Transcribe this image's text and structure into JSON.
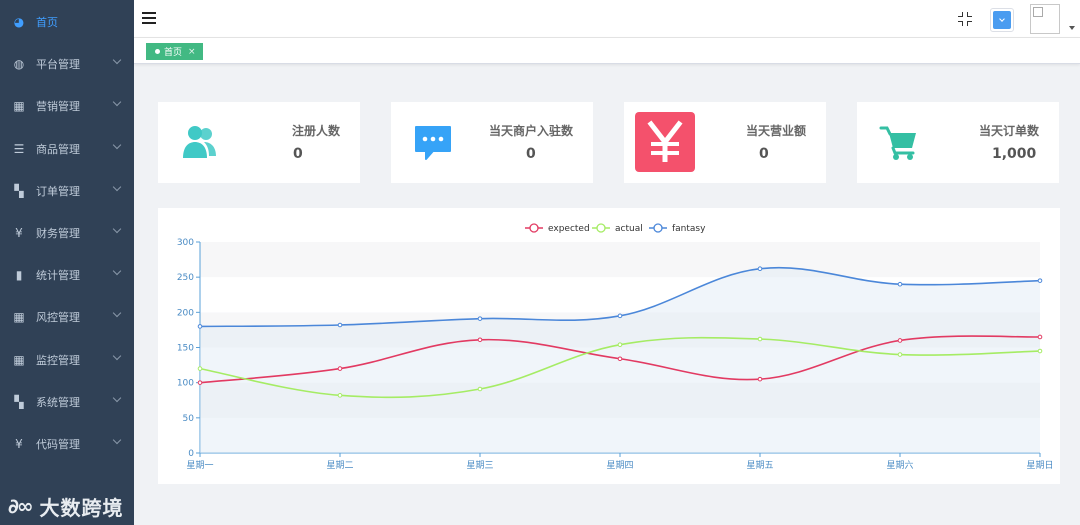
{
  "sidebar": {
    "items": [
      {
        "label": "首页",
        "icon": "dashboard-icon",
        "glyph": "◕",
        "active": true,
        "has_children": false
      },
      {
        "label": "平台管理",
        "icon": "globe-icon",
        "glyph": "◍",
        "active": false,
        "has_children": true
      },
      {
        "label": "营销管理",
        "icon": "table-icon",
        "glyph": "▦",
        "active": false,
        "has_children": true
      },
      {
        "label": "商品管理",
        "icon": "list-icon",
        "glyph": "☰",
        "active": false,
        "has_children": true
      },
      {
        "label": "订单管理",
        "icon": "grid-icon",
        "glyph": "▚",
        "active": false,
        "has_children": true
      },
      {
        "label": "财务管理",
        "icon": "yen-icon",
        "glyph": "¥",
        "active": false,
        "has_children": true
      },
      {
        "label": "统计管理",
        "icon": "bar-chart-icon",
        "glyph": "▮",
        "active": false,
        "has_children": true
      },
      {
        "label": "风控管理",
        "icon": "table-icon",
        "glyph": "▦",
        "active": false,
        "has_children": true
      },
      {
        "label": "监控管理",
        "icon": "table-icon",
        "glyph": "▦",
        "active": false,
        "has_children": true
      },
      {
        "label": "系统管理",
        "icon": "grid-icon",
        "glyph": "▚",
        "active": false,
        "has_children": true
      },
      {
        "label": "代码管理",
        "icon": "yen-icon",
        "glyph": "¥",
        "active": false,
        "has_children": true
      }
    ]
  },
  "watermark": {
    "logo": "∂∞",
    "text": "大数跨境"
  },
  "tags": [
    {
      "label": "首页",
      "close": "×"
    }
  ],
  "cards": [
    {
      "title": "注册人数",
      "value": "0",
      "icon": "peoples-icon",
      "color": "#40c9c6"
    },
    {
      "title": "当天商户入驻数",
      "value": "0",
      "icon": "message-icon",
      "color": "#36a3f7"
    },
    {
      "title": "当天营业额",
      "value": "0",
      "icon": "yen-icon",
      "color": "#f4516c"
    },
    {
      "title": "当天订单数",
      "value": "1,000",
      "icon": "shopping-cart-icon",
      "color": "#34bfa3"
    }
  ],
  "chart_data": {
    "type": "line",
    "categories": [
      "星期一",
      "星期二",
      "星期三",
      "星期四",
      "星期五",
      "星期六",
      "星期日"
    ],
    "series": [
      {
        "name": "expected",
        "color": "#e23a62",
        "values": [
          100,
          120,
          161,
          134,
          105,
          160,
          165
        ]
      },
      {
        "name": "actual",
        "color": "#a5ec64",
        "values": [
          120,
          82,
          91,
          154,
          162,
          140,
          145
        ]
      },
      {
        "name": "fantasy",
        "color": "#4b87d9",
        "values": [
          180,
          182,
          191,
          195,
          262,
          240,
          245
        ],
        "area": true
      }
    ],
    "ylim": [
      0,
      300
    ],
    "yticks": [
      0,
      50,
      100,
      150,
      200,
      250,
      300
    ],
    "legend": "top-center",
    "smooth": true
  }
}
